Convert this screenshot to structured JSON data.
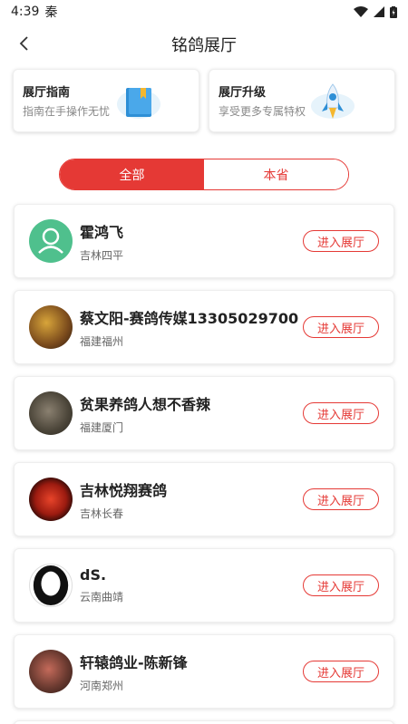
{
  "status": {
    "time": "4:39",
    "carrier": "秦"
  },
  "header": {
    "title": "铭鸽展厅"
  },
  "features": [
    {
      "title": "展厅指南",
      "subtitle": "指南在手操作无忧",
      "icon": "book-icon"
    },
    {
      "title": "展厅升级",
      "subtitle": "享受更多专属特权",
      "icon": "rocket-icon"
    }
  ],
  "tabs": {
    "all": "全部",
    "province": "本省",
    "active": "all"
  },
  "enter_label": "进入展厅",
  "items": [
    {
      "name": "霍鸿飞",
      "location": "吉林四平",
      "avatar": "default-user-avatar"
    },
    {
      "name": "蔡文阳-赛鸽传媒13305029700",
      "location": "福建福州",
      "avatar": "photo-avatar"
    },
    {
      "name": "贫果养鸽人想不香辣",
      "location": "福建厦门",
      "avatar": "photo-avatar"
    },
    {
      "name": "吉林悦翔赛鸽",
      "location": "吉林长春",
      "avatar": "photo-avatar"
    },
    {
      "name": "dS.",
      "location": "云南曲靖",
      "avatar": "silhouette-avatar"
    },
    {
      "name": "轩辕鸽业-陈新锋",
      "location": "河南郑州",
      "avatar": "photo-avatar"
    }
  ]
}
